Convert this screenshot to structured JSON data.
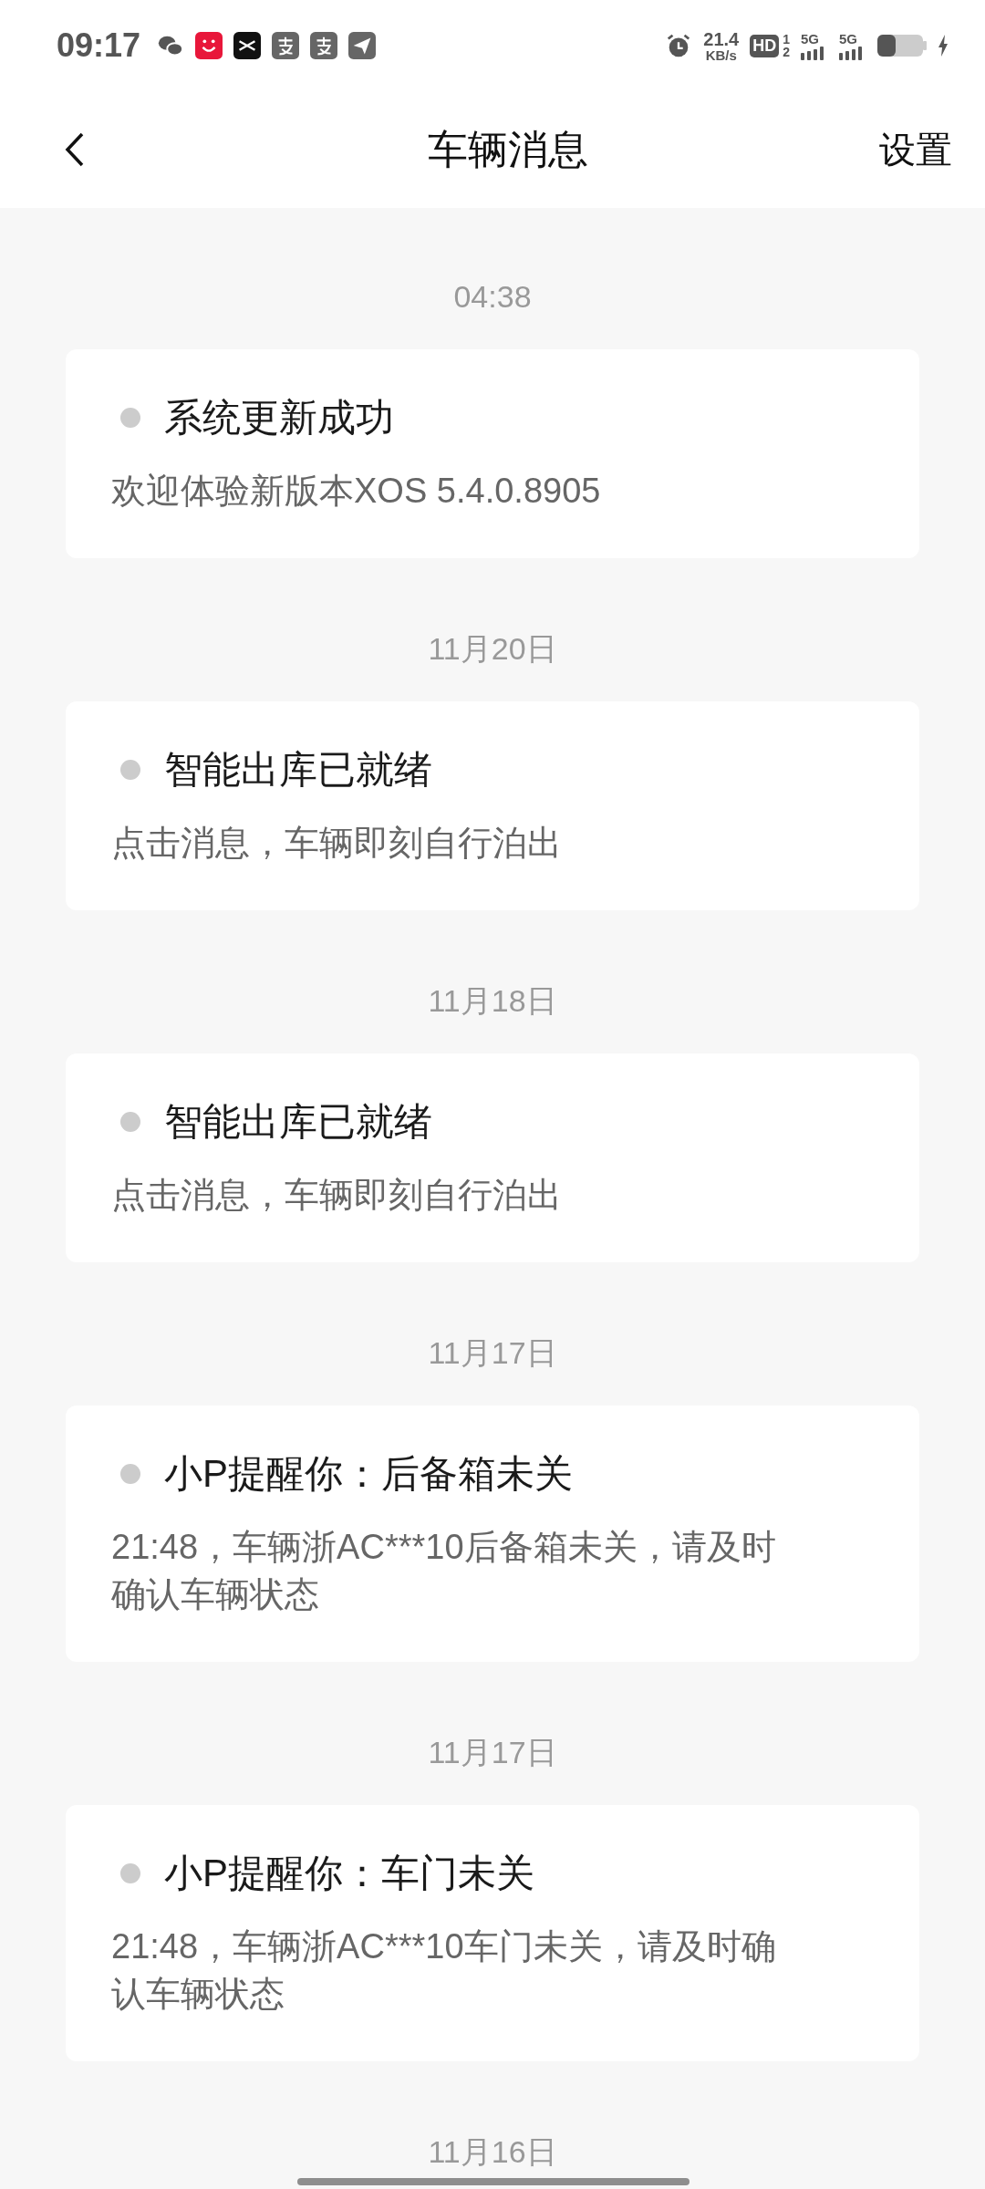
{
  "status_bar": {
    "time": "09:17",
    "net_speed_value": "21.4",
    "net_speed_unit": "KB/s",
    "hd_badge": "HD",
    "hd_slots": [
      "1",
      "2"
    ],
    "sim_labels": [
      "5G",
      "5G"
    ]
  },
  "header": {
    "title": "车辆消息",
    "action": "设置"
  },
  "groups": [
    {
      "date": "04:38",
      "message": {
        "title": "系统更新成功",
        "body": "欢迎体验新版本XOS 5.4.0.8905",
        "read": true
      }
    },
    {
      "date": "11月20日",
      "message": {
        "title": "智能出库已就绪",
        "body": "点击消息，车辆即刻自行泊出",
        "read": true
      }
    },
    {
      "date": "11月18日",
      "message": {
        "title": "智能出库已就绪",
        "body": "点击消息，车辆即刻自行泊出",
        "read": true
      }
    },
    {
      "date": "11月17日",
      "message": {
        "title": "小P提醒你：后备箱未关",
        "body": "21:48，车辆浙AC***10后备箱未关，请及时确认车辆状态",
        "read": true
      }
    },
    {
      "date": "11月17日",
      "message": {
        "title": "小P提醒你：车门未关",
        "body": "21:48，车辆浙AC***10车门未关，请及时确认车辆状态",
        "read": true
      }
    },
    {
      "date": "11月16日"
    }
  ]
}
